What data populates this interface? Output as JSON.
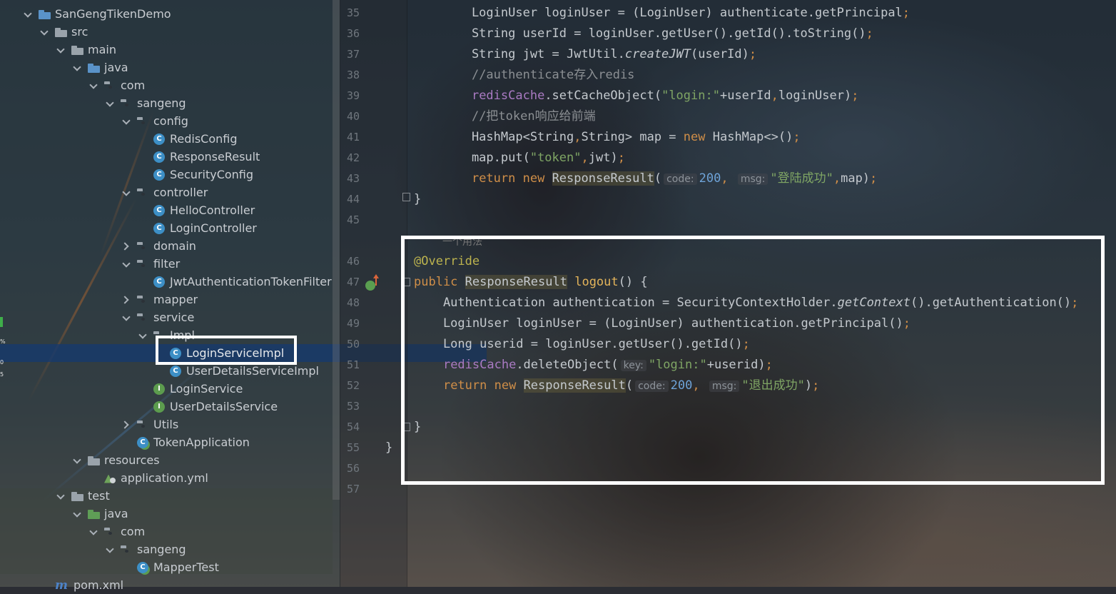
{
  "project_tree": {
    "rows": [
      {
        "label": "SanGengTikenDemo",
        "chev": "down",
        "icon": "module-folder"
      },
      {
        "label": "src",
        "chev": "down",
        "icon": "folder"
      },
      {
        "label": "main",
        "chev": "down",
        "icon": "folder"
      },
      {
        "label": "java",
        "chev": "down",
        "icon": "source-folder"
      },
      {
        "label": "com",
        "chev": "down",
        "icon": "package"
      },
      {
        "label": "sangeng",
        "chev": "down",
        "icon": "package"
      },
      {
        "label": "config",
        "chev": "down",
        "icon": "package"
      },
      {
        "label": "RedisConfig",
        "chev": "none",
        "icon": "class"
      },
      {
        "label": "ResponseResult",
        "chev": "none",
        "icon": "class"
      },
      {
        "label": "SecurityConfig",
        "chev": "none",
        "icon": "class"
      },
      {
        "label": "controller",
        "chev": "down",
        "icon": "package"
      },
      {
        "label": "HelloController",
        "chev": "none",
        "icon": "class"
      },
      {
        "label": "LoginController",
        "chev": "none",
        "icon": "class"
      },
      {
        "label": "domain",
        "chev": "right",
        "icon": "package"
      },
      {
        "label": "filter",
        "chev": "down",
        "icon": "package"
      },
      {
        "label": "JwtAuthenticationTokenFilter",
        "chev": "none",
        "icon": "class"
      },
      {
        "label": "mapper",
        "chev": "right",
        "icon": "package"
      },
      {
        "label": "service",
        "chev": "down",
        "icon": "package"
      },
      {
        "label": "Impl",
        "chev": "down",
        "icon": "package"
      },
      {
        "label": "LoginServiceImpl",
        "chev": "none",
        "icon": "class",
        "selected": true
      },
      {
        "label": "UserDetailsServiceImpl",
        "chev": "none",
        "icon": "class"
      },
      {
        "label": "LoginService",
        "chev": "none",
        "icon": "interface"
      },
      {
        "label": "UserDetailsService",
        "chev": "none",
        "icon": "interface"
      },
      {
        "label": "Utils",
        "chev": "right",
        "icon": "package"
      },
      {
        "label": "TokenApplication",
        "chev": "none",
        "icon": "spring-app"
      },
      {
        "label": "resources",
        "chev": "down",
        "icon": "resources-folder"
      },
      {
        "label": "application.yml",
        "chev": "none",
        "icon": "yml-file"
      },
      {
        "label": "test",
        "chev": "down",
        "icon": "folder"
      },
      {
        "label": "java",
        "chev": "down",
        "icon": "test-folder"
      },
      {
        "label": "com",
        "chev": "down",
        "icon": "package"
      },
      {
        "label": "sangeng",
        "chev": "down",
        "icon": "package"
      },
      {
        "label": "MapperTest",
        "chev": "none",
        "icon": "spring-app"
      },
      {
        "label": "pom.xml",
        "chev": "none",
        "icon": "maven-file"
      }
    ]
  },
  "gauge": [
    "%",
    "0",
    "5"
  ],
  "editor": {
    "lines": [
      {
        "n": "35",
        "html": "    LoginUser loginUser = (LoginUser) authenticate.getPrincipal<span class=\"kw\">;</span>"
      },
      {
        "n": "36",
        "html": "    String userId = loginUser.getUser().getId().toString()<span class=\"kw\">;</span>"
      },
      {
        "n": "37",
        "html": "    String jwt = JwtUtil.<span class=\"it\">createJWT</span>(userId)<span class=\"kw\">;</span>"
      },
      {
        "n": "38",
        "html": "    <span class=\"cm\">//authenticate存入redis</span>"
      },
      {
        "n": "39",
        "html": "    <span class=\"fld\">redisCache</span>.setCacheObject(<span class=\"str\">\"login:\"</span>+userId<span class=\"kw\">,</span>loginUser)<span class=\"kw\">;</span>"
      },
      {
        "n": "40",
        "html": "    <span class=\"cm\">//把token响应给前端</span>"
      },
      {
        "n": "41",
        "html": "    HashMap&lt;String<span class=\"kw\">,</span>String&gt; map = <span class=\"kw\">new</span> HashMap&lt;&gt;()<span class=\"kw\">;</span>"
      },
      {
        "n": "42",
        "html": "    map.put(<span class=\"str\">\"token\"</span><span class=\"kw\">,</span>jwt)<span class=\"kw\">;</span>"
      },
      {
        "n": "43",
        "html": "    <span class=\"kw\">return new</span> <span class=\"cls\">ResponseResult</span>(<span class=\"hint\">code:</span><span class=\"num\">200</span><span class=\"kw\">,</span> <span class=\"hint\">msg:</span><span class=\"str\">\"登陆成功\"</span><span class=\"kw\">,</span>map)<span class=\"kw\">;</span>"
      },
      {
        "n": "44",
        "html": "}"
      },
      {
        "n": "45",
        "html": ""
      },
      {
        "n": "46",
        "html": "<span class=\"ann\">@Override</span>"
      },
      {
        "n": "47",
        "html": "<span class=\"kw\">public</span> <span class=\"cls\">ResponseResult</span> <span class=\"fn\">logout</span>() {"
      },
      {
        "n": "48",
        "html": "    Authentication authentication = SecurityContextHolder.<span class=\"it\">getContext</span>().getAuthentication()<span class=\"kw\">;</span>"
      },
      {
        "n": "49",
        "html": "    LoginUser loginUser = (LoginUser) authentication.getPrincipal()<span class=\"kw\">;</span>"
      },
      {
        "n": "50",
        "html": "    Long userid = loginUser.getUser().getId()<span class=\"kw\">;</span>"
      },
      {
        "n": "51",
        "html": "    <span class=\"fld\">redisCache</span>.deleteObject(<span class=\"hint\">key:</span><span class=\"str\">\"login:\"</span>+userid)<span class=\"kw\">;</span>"
      },
      {
        "n": "52",
        "html": "    <span class=\"kw\">return new</span> <span class=\"cls\">ResponseResult</span>(<span class=\"hint\">code:</span><span class=\"num\">200</span><span class=\"kw\">,</span> <span class=\"hint\">msg:</span><span class=\"str\">\"退出成功\"</span>)<span class=\"kw\">;</span>"
      },
      {
        "n": "53",
        "html": ""
      },
      {
        "n": "54",
        "html": "}"
      },
      {
        "n": "55",
        "html": "}"
      },
      {
        "n": "56",
        "html": ""
      },
      {
        "n": "57",
        "html": ""
      }
    ],
    "collapsed_hint": "一个用法"
  },
  "colors": {
    "keyword": "#cf8e48",
    "string": "#7fa564",
    "number": "#6ea3d8",
    "field": "#a97ac2",
    "annotation": "#bcb34e",
    "selection": "#163a6e",
    "highlight_box": "#ffffff"
  }
}
